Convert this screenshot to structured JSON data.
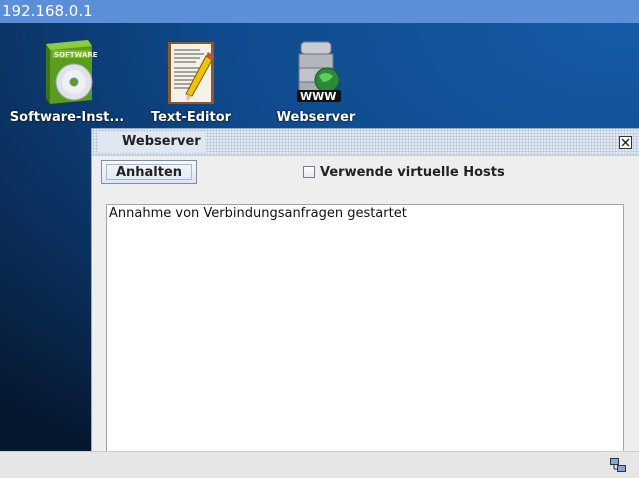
{
  "titlebar": {
    "address": "192.168.0.1"
  },
  "desktop": {
    "icons": [
      {
        "label": "Software-Inst...",
        "icon": "software-installer-icon"
      },
      {
        "label": "Text-Editor",
        "icon": "text-editor-icon"
      },
      {
        "label": "Webserver",
        "icon": "webserver-icon"
      }
    ]
  },
  "window": {
    "title": "Webserver",
    "stop_button_label": "Anhalten",
    "virtual_hosts_label": "Verwende virtuelle Hosts",
    "virtual_hosts_checked": false,
    "log_text": "Annahme von Verbindungsanfragen gestartet"
  },
  "statusbar": {
    "icon": "network-icon"
  },
  "colors": {
    "titlebar": "#5d8fd8",
    "desktop": "#0f4a8c",
    "window_bg": "#eeeeee"
  }
}
